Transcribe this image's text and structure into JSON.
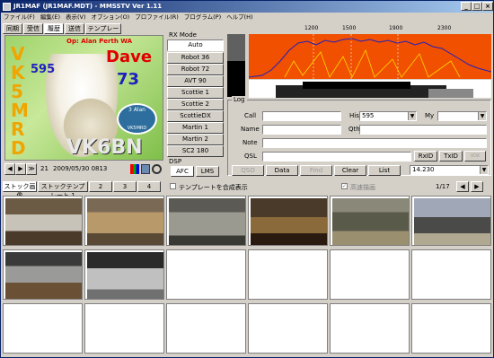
{
  "window": {
    "title": "JR1MAF (JR1MAF.MDT) - MMSSTV Ver 1.11",
    "min": "_",
    "max": "□",
    "close": "×"
  },
  "menu": [
    "ファイル(F)",
    "編集(E)",
    "表示(V)",
    "オプション(O)",
    "プロファイル(R)",
    "プログラム(P)",
    "ヘルプ(H)"
  ],
  "tabs": [
    "同期",
    "受信",
    "履歴",
    "送信",
    "テンプレート"
  ],
  "active_tab": "履歴",
  "picture": {
    "callsign_left": [
      "V",
      "K",
      "5",
      "M",
      "R",
      "D"
    ],
    "number": "595",
    "op_line": "Op: Alan   Perth WA",
    "name": "Dave",
    "rst": "73",
    "callsign": "VK6BN",
    "badge_text": "3 Alan",
    "badge_sub": "VK5MRD"
  },
  "nav": {
    "prev": "◀",
    "next": "▶",
    "last": "≫",
    "counter": "21",
    "timestamp": "2009/05/30 0813"
  },
  "rx_mode": {
    "label": "RX Mode",
    "modes": [
      "Auto",
      "Robot 36",
      "Robot 72",
      "AVT 90",
      "Scottie 1",
      "Scottie 2",
      "ScottieDX",
      "Martin 1",
      "Martin 2",
      "SC2 180"
    ]
  },
  "dsp": {
    "label": "DSP",
    "afc": "AFC",
    "lms": "LMS"
  },
  "spectrum": {
    "ticks": [
      "1200",
      "1500",
      "1900",
      "2300"
    ]
  },
  "log": {
    "label": "Log",
    "call_label": "Call",
    "call_value": "",
    "his_label": "His",
    "his_value": "595",
    "my_label": "My",
    "my_value": "",
    "name_label": "Name",
    "name_value": "",
    "qth_label": "Qth",
    "qth_value": "",
    "note_label": "Note",
    "note_value": "",
    "qsl_label": "QSL",
    "qsl_value": "",
    "rxid": "RxID",
    "txid": "TxID",
    "vox": "VOX",
    "qso": "QSO",
    "data": "Data",
    "find": "Find",
    "clear": "Clear",
    "list": "List",
    "freq": "14.230"
  },
  "stock": {
    "tabs": [
      "ストック画像",
      "ストックテンプレート 1",
      "2",
      "3",
      "4"
    ],
    "checkbox_label": "テンプレートを合成表示",
    "fast_label": "高速描画",
    "page": "1/17"
  },
  "photos": [
    {
      "bg": "#6b5a44",
      "fg": "#c8c3b8"
    },
    {
      "bg": "#7a6a55",
      "fg": "#b89a6a"
    },
    {
      "bg": "#5c5a55",
      "fg": "#9a9a90"
    },
    {
      "bg": "#4a3a2a",
      "fg": "#8a6a3a"
    },
    {
      "bg": "#8a8878",
      "fg": "#5a5a4a"
    },
    {
      "bg": "#a0a8b8",
      "fg": "#4a4a48"
    },
    {
      "bg": "#3a3a3a",
      "fg": "#9a9a98"
    },
    {
      "bg": "#2a2a2a",
      "fg": "#c0c0c0"
    }
  ],
  "colors": {
    "titlebar": "#0a246a",
    "spectrum_bg": "#f05000",
    "spectrum_line": "#2020c0",
    "pic_text": "#f0a500",
    "callsign": "#e8e8e8"
  }
}
